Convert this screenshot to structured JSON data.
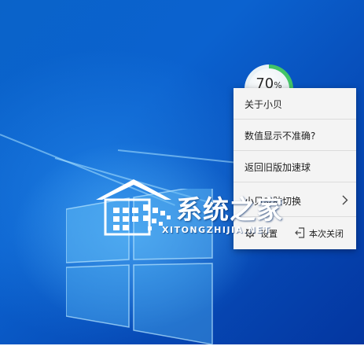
{
  "speed_ball": {
    "value": "70",
    "unit": "%",
    "level": 0.7,
    "ring_color": "#43c466"
  },
  "context_menu": {
    "items": [
      {
        "label": "关于小贝"
      },
      {
        "label": "数值显示不准确?"
      },
      {
        "label": "返回旧版加速球"
      },
      {
        "label": "小贝皮肤切换"
      }
    ],
    "settings_label": "设置",
    "close_label": "本次关闭"
  },
  "watermark": {
    "title": "系统之家",
    "subtitle": "XITONGZHIJIA.NET",
    "color": "#ffffff"
  },
  "colors": {
    "desktop_blue": "#0b62cf",
    "menu_bg": "#f4f4f4"
  }
}
